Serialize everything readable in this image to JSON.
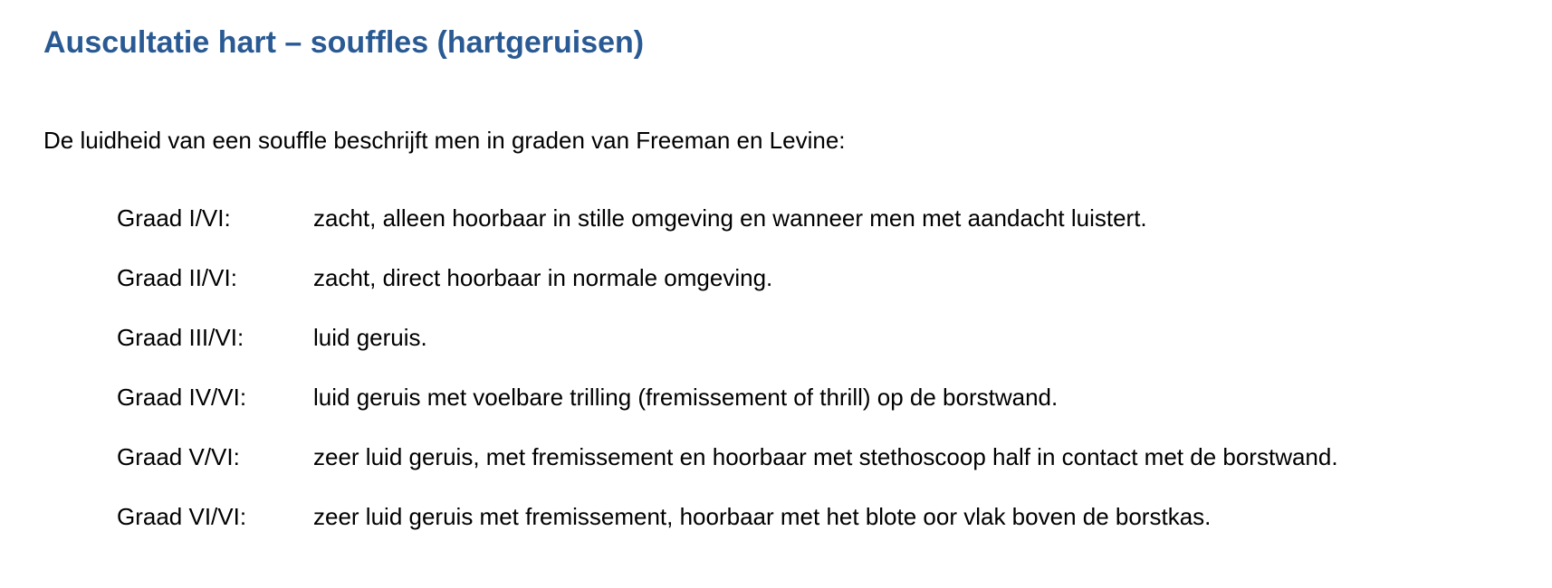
{
  "document": {
    "title": "Auscultatie hart – souffles (hartgeruisen)",
    "intro": "De luidheid van een souffle beschrijft men in graden van Freeman en Levine:",
    "grades": [
      {
        "label": "Graad I/VI:",
        "description": "zacht, alleen hoorbaar in stille omgeving en wanneer men met aandacht luistert."
      },
      {
        "label": "Graad II/VI:",
        "description": "zacht, direct hoorbaar in normale omgeving."
      },
      {
        "label": "Graad III/VI:",
        "description": "luid geruis."
      },
      {
        "label": "Graad IV/VI:",
        "description": "luid geruis met voelbare trilling (fremissement of thrill) op de borstwand."
      },
      {
        "label": "Graad V/VI:",
        "description": "zeer luid geruis, met fremissement en hoorbaar met stethoscoop half in contact met de borstwand."
      },
      {
        "label": "Graad VI/VI:",
        "description": "zeer luid geruis met fremissement, hoorbaar met het blote oor vlak boven de borstkas."
      }
    ]
  },
  "colors": {
    "title": "#2a5a93",
    "text": "#000000",
    "background": "#ffffff"
  }
}
